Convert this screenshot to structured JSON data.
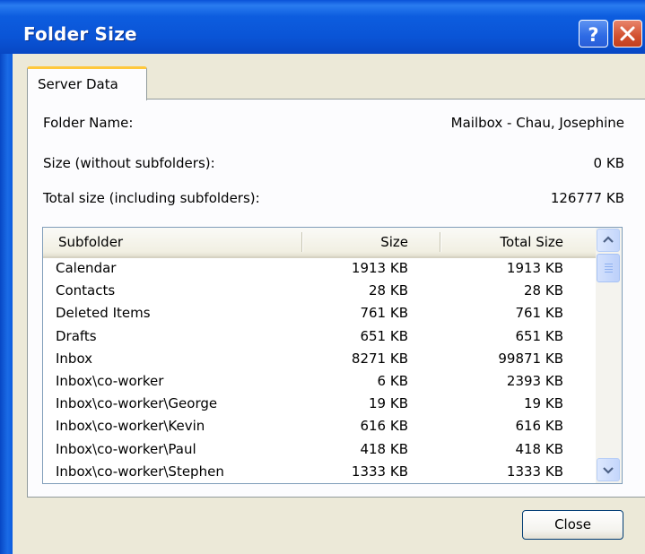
{
  "window": {
    "title": "Folder Size",
    "help_icon": "help-question-icon",
    "close_icon": "close-x-icon",
    "accent_color": "#0a54d6"
  },
  "tab": {
    "label": "Server Data"
  },
  "fields": {
    "folder_name_label": "Folder Name:",
    "folder_name_value": "Mailbox - Chau, Josephine",
    "size_label": "Size (without subfolders):",
    "size_value": "0 KB",
    "total_label": "Total size (including subfolders):",
    "total_value": "126777 KB"
  },
  "table": {
    "columns": [
      "Subfolder",
      "Size",
      "Total Size"
    ],
    "rows": [
      {
        "name": "Calendar",
        "size": "1913 KB",
        "total": "1913 KB"
      },
      {
        "name": "Contacts",
        "size": "28 KB",
        "total": "28 KB"
      },
      {
        "name": "Deleted Items",
        "size": "761 KB",
        "total": "761 KB"
      },
      {
        "name": "Drafts",
        "size": "651 KB",
        "total": "651 KB"
      },
      {
        "name": "Inbox",
        "size": "8271 KB",
        "total": "99871 KB"
      },
      {
        "name": "Inbox\\co-worker",
        "size": "6 KB",
        "total": "2393 KB"
      },
      {
        "name": "Inbox\\co-worker\\George",
        "size": "19 KB",
        "total": "19 KB"
      },
      {
        "name": "Inbox\\co-worker\\Kevin",
        "size": "616 KB",
        "total": "616 KB"
      },
      {
        "name": "Inbox\\co-worker\\Paul",
        "size": "418 KB",
        "total": "418 KB"
      },
      {
        "name": "Inbox\\co-worker\\Stephen",
        "size": "1333 KB",
        "total": "1333 KB"
      }
    ]
  },
  "buttons": {
    "close_label": "Close"
  }
}
